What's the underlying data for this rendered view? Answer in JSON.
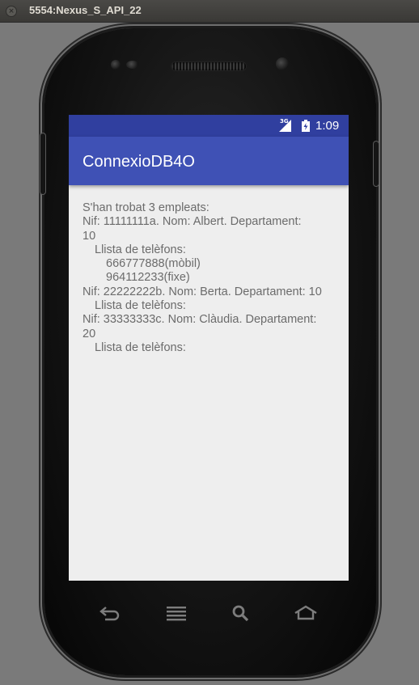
{
  "window": {
    "title": "5554:Nexus_S_API_22"
  },
  "status_bar": {
    "network": "3G",
    "time": "1:09"
  },
  "app_bar": {
    "title": "ConnexioDB4O"
  },
  "content": {
    "summary": "S'han trobat 3 empleats:",
    "employees": [
      {
        "info_line1": "Nif: 11111111a. Nom: Albert. Departament:",
        "info_line2": "10",
        "phones_header": "Llista de telèfons:",
        "phones": [
          "666777888(mòbil)",
          "964112233(fixe)"
        ]
      },
      {
        "info_line1": "Nif: 22222222b. Nom: Berta. Departament: 10",
        "phones_header": "Llista de telèfons:",
        "phones": []
      },
      {
        "info_line1": "Nif: 33333333c. Nom: Clàudia. Departament:",
        "info_line2": "20",
        "phones_header": "Llista de telèfons:",
        "phones": []
      }
    ]
  },
  "nav_icons": [
    "back-icon",
    "menu-icon",
    "search-icon",
    "home-icon"
  ],
  "colors": {
    "status_bar": "#303f9f",
    "app_bar": "#3f51b5",
    "screen_background": "#eeeeee",
    "text": "#6b6b6b"
  }
}
